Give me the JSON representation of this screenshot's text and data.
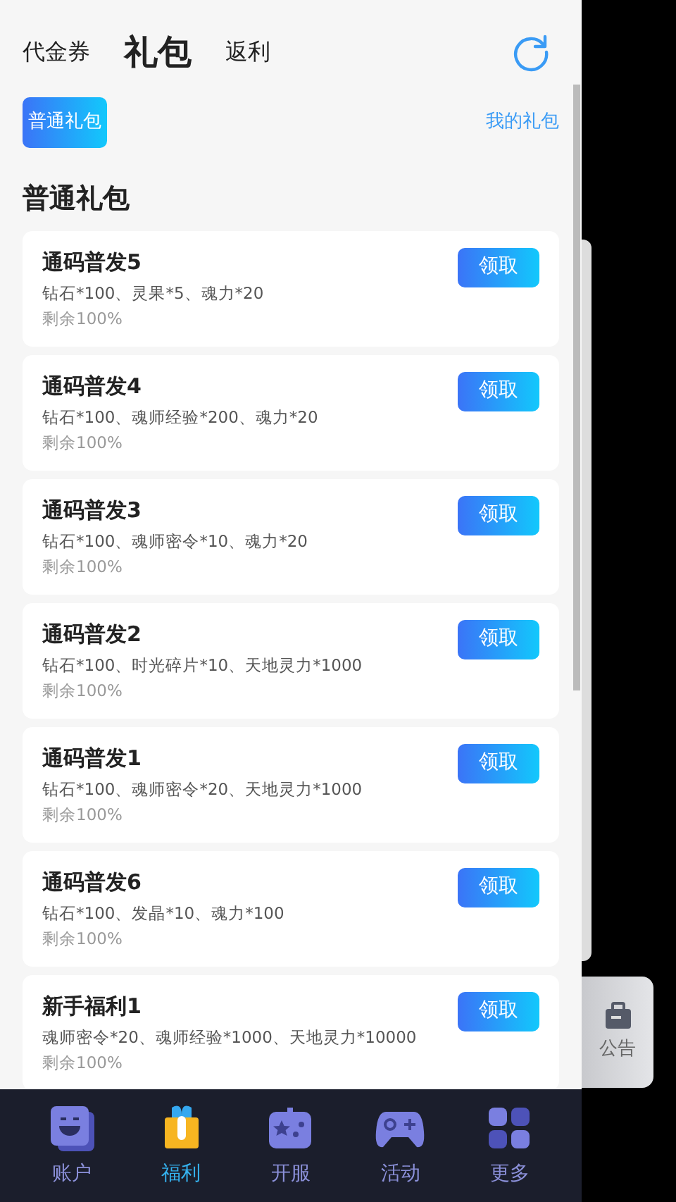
{
  "tabs": [
    {
      "label": "代金券",
      "selected": false
    },
    {
      "label": "礼包",
      "selected": true
    },
    {
      "label": "返利",
      "selected": false
    }
  ],
  "filters": [
    {
      "label": "普通礼包",
      "selected": true
    }
  ],
  "my_gifts_link": "我的礼包",
  "section_title": "普通礼包",
  "gifts": [
    {
      "title": "通码普发5",
      "contents": "钻石*100、灵果*5、魂力*20",
      "remaining": "剩余100%",
      "button": "领取"
    },
    {
      "title": "通码普发4",
      "contents": "钻石*100、魂师经验*200、魂力*20",
      "remaining": "剩余100%",
      "button": "领取"
    },
    {
      "title": "通码普发3",
      "contents": "钻石*100、魂师密令*10、魂力*20",
      "remaining": "剩余100%",
      "button": "领取"
    },
    {
      "title": "通码普发2",
      "contents": "钻石*100、时光碎片*10、天地灵力*1000",
      "remaining": "剩余100%",
      "button": "领取"
    },
    {
      "title": "通码普发1",
      "contents": "钻石*100、魂师密令*20、天地灵力*1000",
      "remaining": "剩余100%",
      "button": "领取"
    },
    {
      "title": "通码普发6",
      "contents": "钻石*100、发晶*10、魂力*100",
      "remaining": "剩余100%",
      "button": "领取"
    },
    {
      "title": "新手福利1",
      "contents": "魂师密令*20、魂师经验*1000、天地灵力*10000",
      "remaining": "剩余100%",
      "button": "领取"
    }
  ],
  "notice_button": "公告",
  "bottom_nav": [
    {
      "label": "账户",
      "kind": "account",
      "selected": false
    },
    {
      "label": "福利",
      "kind": "gift",
      "selected": true
    },
    {
      "label": "开服",
      "kind": "server",
      "selected": false
    },
    {
      "label": "活动",
      "kind": "gamepad",
      "selected": false
    },
    {
      "label": "更多",
      "kind": "more",
      "selected": false
    }
  ]
}
